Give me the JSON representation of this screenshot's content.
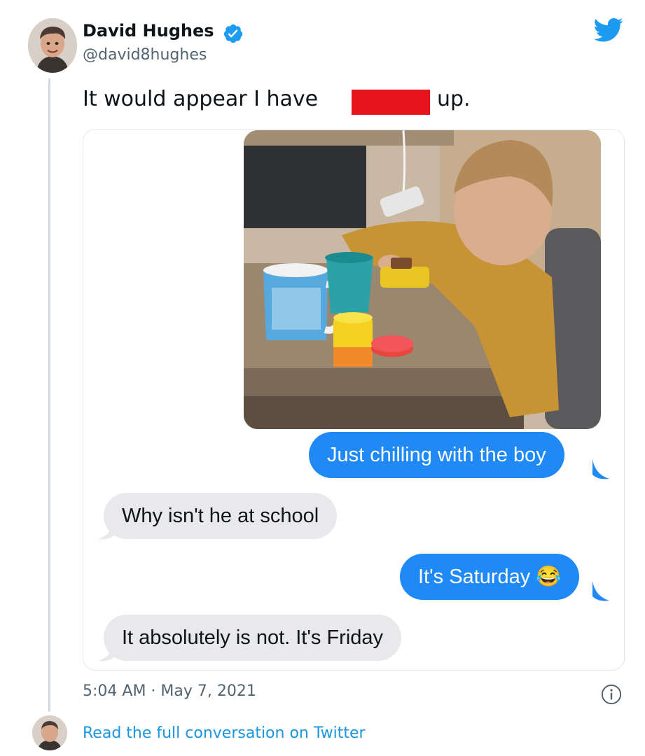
{
  "author": {
    "name": "David Hughes",
    "handle": "@david8hughes",
    "verified_icon": "verified-badge-icon",
    "avatar_icon": "avatar"
  },
  "tweet": {
    "text_before": "It would appear I have",
    "text_after": "up."
  },
  "messages": [
    {
      "text": "Just chilling with the boy",
      "direction": "outgoing"
    },
    {
      "text": "Why isn't he at school",
      "direction": "incoming"
    },
    {
      "text": "It's Saturday 😂",
      "direction": "outgoing"
    },
    {
      "text": "It absolutely is not. It's Friday",
      "direction": "incoming"
    }
  ],
  "meta": {
    "timestamp": "5:04 AM · May 7, 2021",
    "read_more": "Read the full conversation on Twitter"
  },
  "colors": {
    "twitter_blue": "#1d9bf0",
    "imessage_blue": "#1f8af6",
    "received_gray": "#e9e9eb",
    "redaction_red": "#e8141c"
  }
}
